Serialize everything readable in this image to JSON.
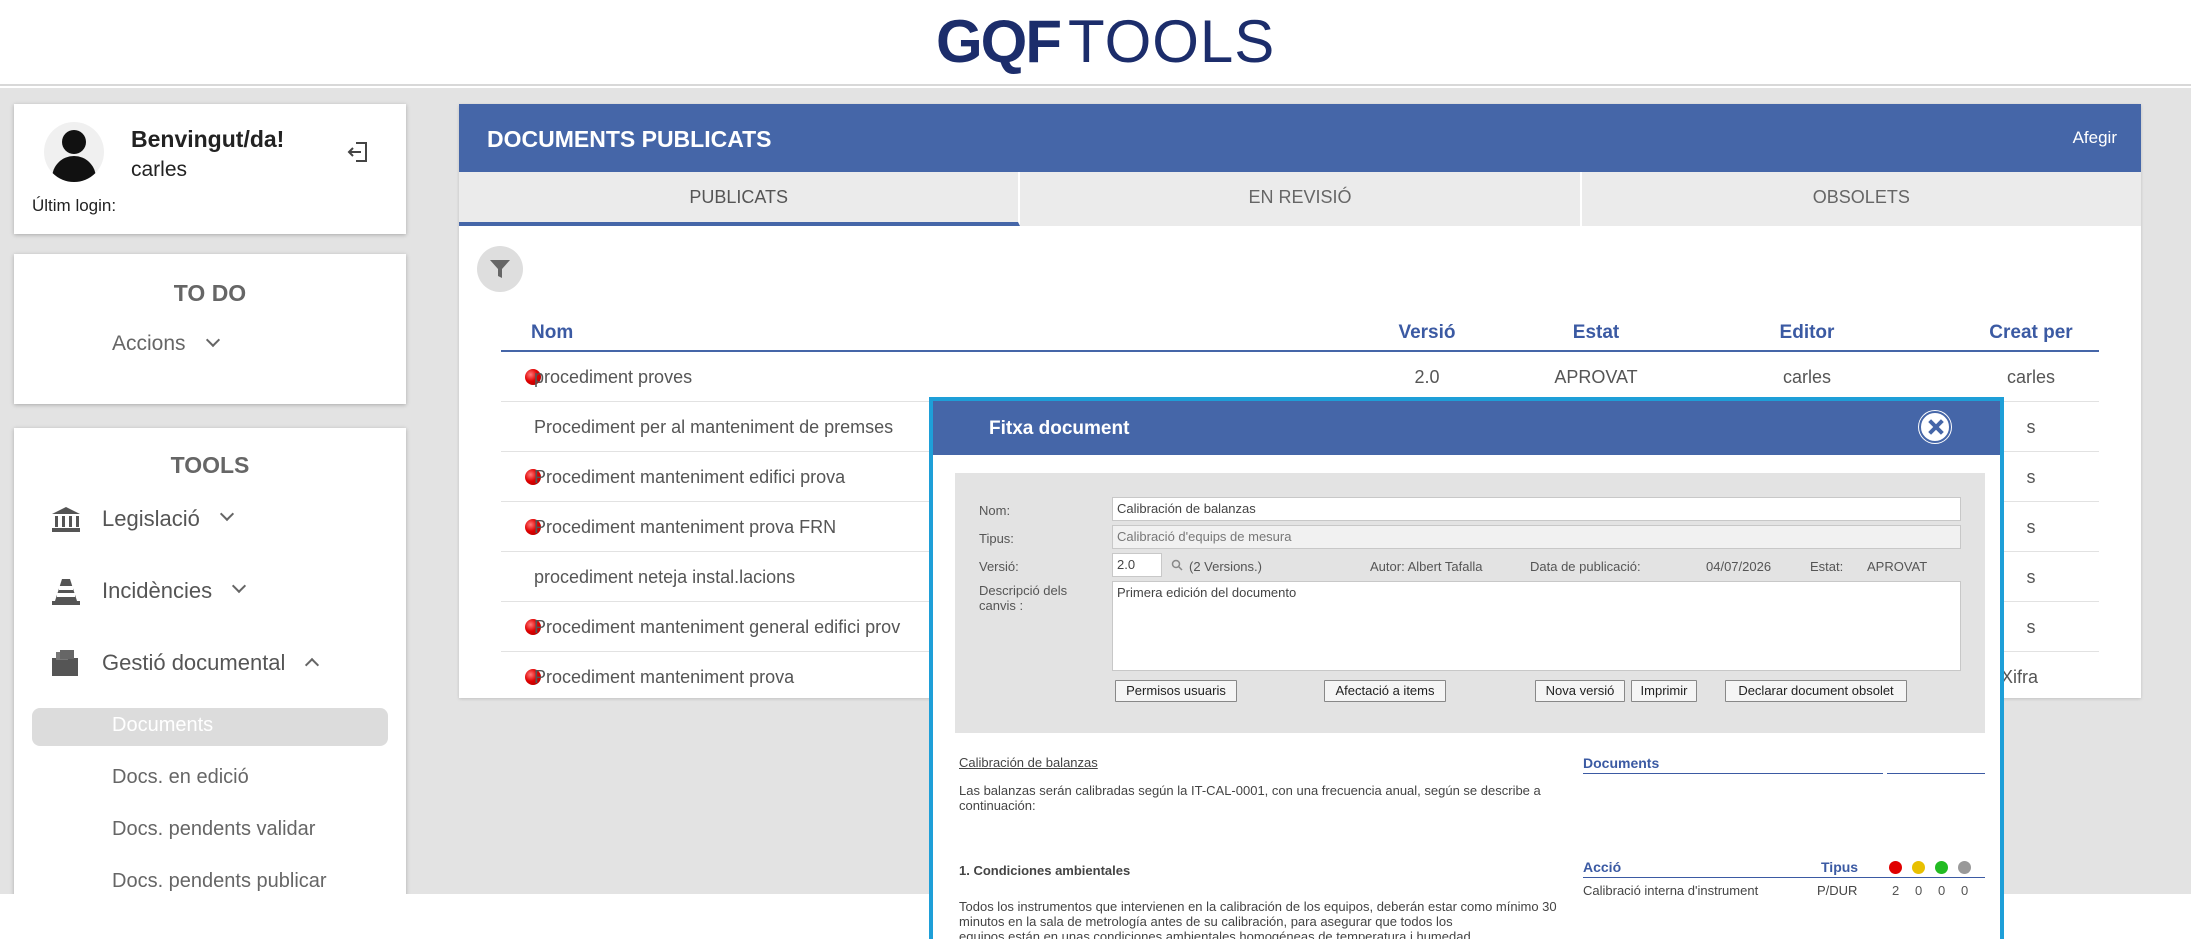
{
  "header": {
    "logo_left": "GQF",
    "logo_right": "TOOLS"
  },
  "user": {
    "welcome": "Benvingut/da!",
    "name": "carles",
    "last_login_label": "Últim login:"
  },
  "todo": {
    "title": "TO DO",
    "actions_label": "Accions"
  },
  "tools": {
    "title": "TOOLS",
    "items": [
      {
        "label": "Legislació",
        "icon": "bank-icon"
      },
      {
        "label": "Incidències",
        "icon": "traffic-cone-icon"
      },
      {
        "label": "Gestió documental",
        "icon": "folder-icon"
      }
    ],
    "sub_items": [
      "Documents",
      "Docs. en edició",
      "Docs. pendents validar",
      "Docs. pendents publicar"
    ]
  },
  "main": {
    "title": "DOCUMENTS PUBLICATS",
    "add_label": "Afegir",
    "tabs": [
      "PUBLICATS",
      "EN REVISIÓ",
      "OBSOLETS"
    ],
    "columns": [
      "Nom",
      "Versió",
      "Estat",
      "Editor",
      "Creat per"
    ],
    "rows": [
      {
        "dot": true,
        "name": "procediment proves",
        "version": "2.0",
        "state": "APROVAT",
        "editor": "carles",
        "creator": "carles"
      },
      {
        "dot": false,
        "name": "Procediment per al manteniment de premses",
        "creator": "s"
      },
      {
        "dot": true,
        "name": "Procediment manteniment edifici prova",
        "creator": "s"
      },
      {
        "dot": true,
        "name": "Procediment manteniment prova FRN",
        "creator": "s"
      },
      {
        "dot": false,
        "name": "procediment neteja instal.lacions",
        "creator": "s"
      },
      {
        "dot": true,
        "name": "Procediment manteniment general edifici prov",
        "creator": "s"
      },
      {
        "dot": true,
        "name": "Procediment manteniment prova",
        "creator": "Xifra"
      }
    ]
  },
  "modal": {
    "title": "Fitxa document",
    "labels": {
      "nom": "Nom:",
      "tipus": "Tipus:",
      "versio": "Versió:",
      "descripcio": "Descripció dels canvis :",
      "autor": "Autor: Albert Tafalla",
      "data": "Data de publicació:",
      "data_value": "04/07/2026",
      "estat": "Estat:",
      "estat_value": "APROVAT",
      "versions": "(2 Versions.)"
    },
    "values": {
      "nom": "Calibración de balanzas",
      "tipus": "Calibració d'equips de mesura",
      "versio": "2.0",
      "descripcio": "Primera edición del documento"
    },
    "buttons": [
      "Permisos usuaris",
      "Afectació a items",
      "Nova versió",
      "Imprimir",
      "Declarar document obsolet"
    ],
    "doc_title": "Calibración de balanzas",
    "doc_intro_1": "Las balanzas serán calibradas según la IT-CAL-0001, con una frecuencia anual, según se describe a",
    "doc_intro_2": "continuación:",
    "section_1": "1. Condiciones ambientales",
    "section_text_1": "Todos los instrumentos que intervienen en la calibración de los equipos, deberán estar como mínimo 30",
    "section_text_2": "minutos en la sala de metrología antes de su calibración, para asegurar que todos los",
    "section_text_3": "equipos están en unas condiciones ambientales homogéneas de temperatura i humedad.",
    "right": {
      "documents": "Documents",
      "accio": "Acció",
      "tipus": "Tipus",
      "row_action": "Calibració interna d'instrument",
      "row_type": "P/DUR",
      "counts": [
        "2",
        "0",
        "0",
        "0"
      ],
      "status_colors": [
        "#e00000",
        "#e8c000",
        "#22bb22",
        "#999999"
      ]
    }
  }
}
